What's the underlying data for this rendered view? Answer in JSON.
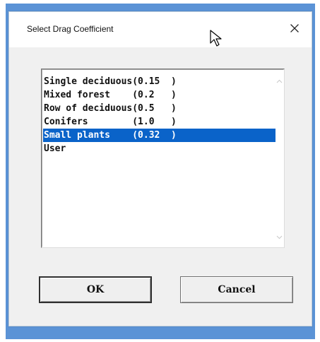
{
  "window": {
    "title": "Select Drag Coefficient"
  },
  "list": {
    "items": [
      {
        "text": "Single deciduous(0.15  )"
      },
      {
        "text": "Mixed forest    (0.2   )"
      },
      {
        "text": "Row of deciduous(0.5   )"
      },
      {
        "text": "Conifers        (1.0   )"
      },
      {
        "text": "Small plants    (0.32  )",
        "selected": true
      },
      {
        "text": "User"
      }
    ]
  },
  "buttons": {
    "ok_label": "OK",
    "cancel_label": "Cancel"
  },
  "icons": {
    "close": "close-icon",
    "cursor": "mouse-pointer-icon",
    "scroll_up": "chevron-up-icon",
    "scroll_down": "chevron-down-icon"
  },
  "colors": {
    "selection": "#0a63c9",
    "frame": "#5b93d6"
  }
}
